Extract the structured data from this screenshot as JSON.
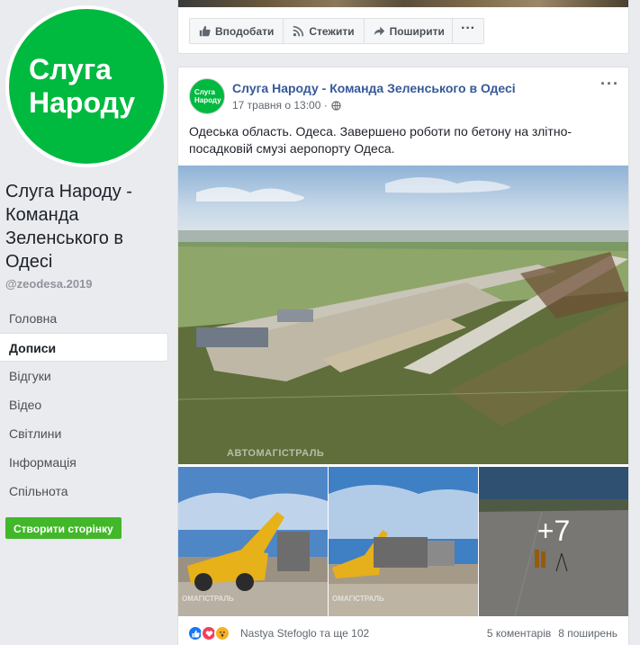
{
  "page": {
    "logo_line1": "Слуга",
    "logo_line2": "Народу",
    "name": "Слуга Народу - Команда Зеленського в Одесі",
    "handle": "@zeodesa.2019",
    "create_page_button": "Створити сторінку"
  },
  "sidebar": {
    "items": [
      {
        "label": "Головна",
        "active": false
      },
      {
        "label": "Дописи",
        "active": true
      },
      {
        "label": "Відгуки",
        "active": false
      },
      {
        "label": "Відео",
        "active": false
      },
      {
        "label": "Світлини",
        "active": false
      },
      {
        "label": "Інформація",
        "active": false
      },
      {
        "label": "Спільнота",
        "active": false
      }
    ]
  },
  "top_actions": {
    "like": "Вподобати",
    "follow": "Стежити",
    "share": "Поширити",
    "more": "···"
  },
  "post": {
    "avatar_line1": "Слуга",
    "avatar_line2": "Народу",
    "author": "Слуга Народу - Команда Зеленського в Одесі",
    "timestamp": "17 травня о 13:00 ·",
    "menu": "···",
    "text": "Одеська область. Одеса. Завершено роботи по бетону на злітно-посадковій смузі аеропорту Одеса.",
    "photo_watermark": "АВТОМАГІСТРАЛЬ",
    "thumb_watermark": "ОМАГІСТРАЛЬ",
    "more_photos": "+7",
    "reactors": "Nastya Stefoglo та ще 102",
    "comments": "5 коментарів",
    "shares": "8 поширень"
  },
  "colors": {
    "brand_green": "#00b93f",
    "link_blue": "#365899",
    "create_green": "#42b72a",
    "like_blue": "#1877f2",
    "love_red": "#f33e58",
    "wow_yellow": "#f7b125"
  }
}
